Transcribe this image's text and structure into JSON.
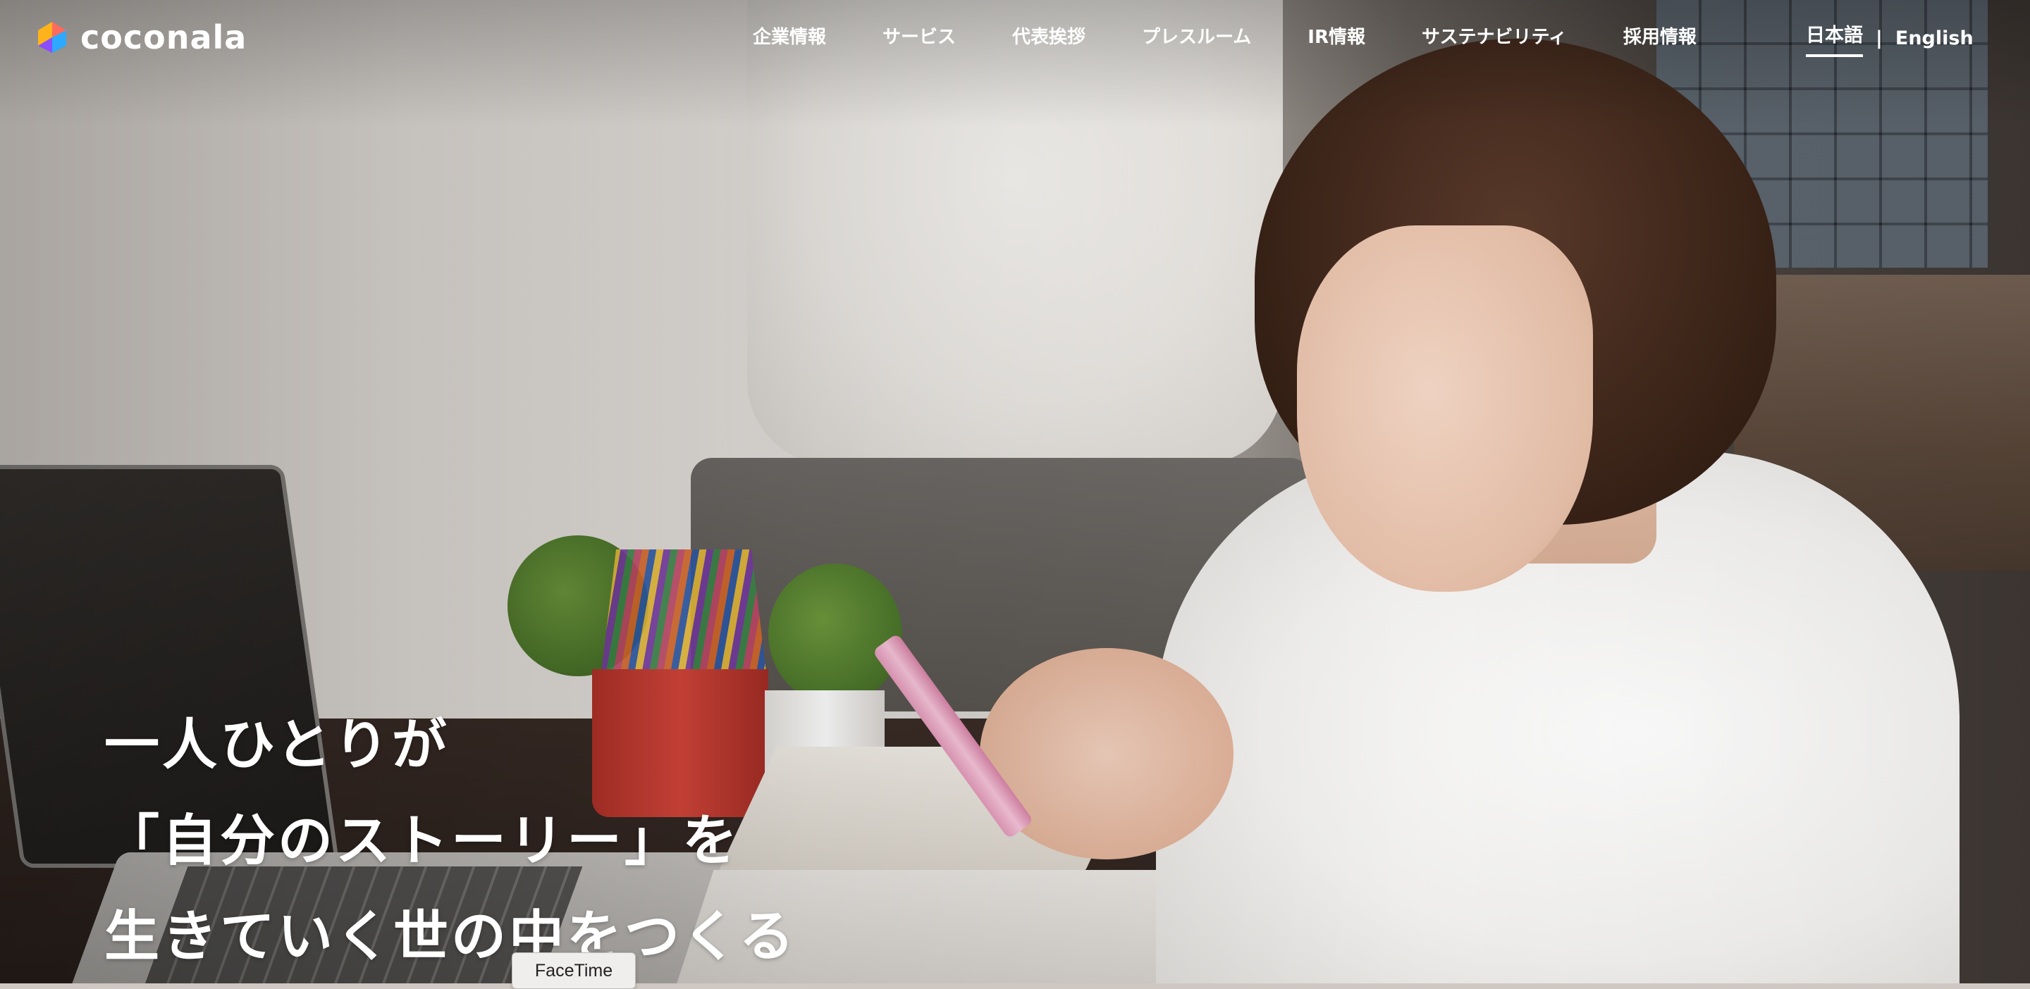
{
  "header": {
    "logo_text": "coconala",
    "logo_colors": [
      "#ff6a5c",
      "#ffb31a",
      "#2fa8ff",
      "#8a4dff"
    ],
    "nav_items": [
      {
        "label": "企業情報",
        "name": "nav-company-info"
      },
      {
        "label": "サービス",
        "name": "nav-services"
      },
      {
        "label": "代表挨拶",
        "name": "nav-ceo-message"
      },
      {
        "label": "プレスルーム",
        "name": "nav-press-room"
      },
      {
        "label": "IR情報",
        "name": "nav-ir"
      },
      {
        "label": "サステナビリティ",
        "name": "nav-sustainability"
      },
      {
        "label": "採用情報",
        "name": "nav-recruitment"
      }
    ],
    "languages": {
      "japanese": "日本語",
      "separator": "|",
      "english": "English",
      "active": "japanese"
    }
  },
  "hero": {
    "headline_lines": [
      "一人ひとりが",
      "「自分のストーリー」を",
      "生きていく世の中をつくる"
    ]
  },
  "tooltip": {
    "text": "FaceTime"
  }
}
